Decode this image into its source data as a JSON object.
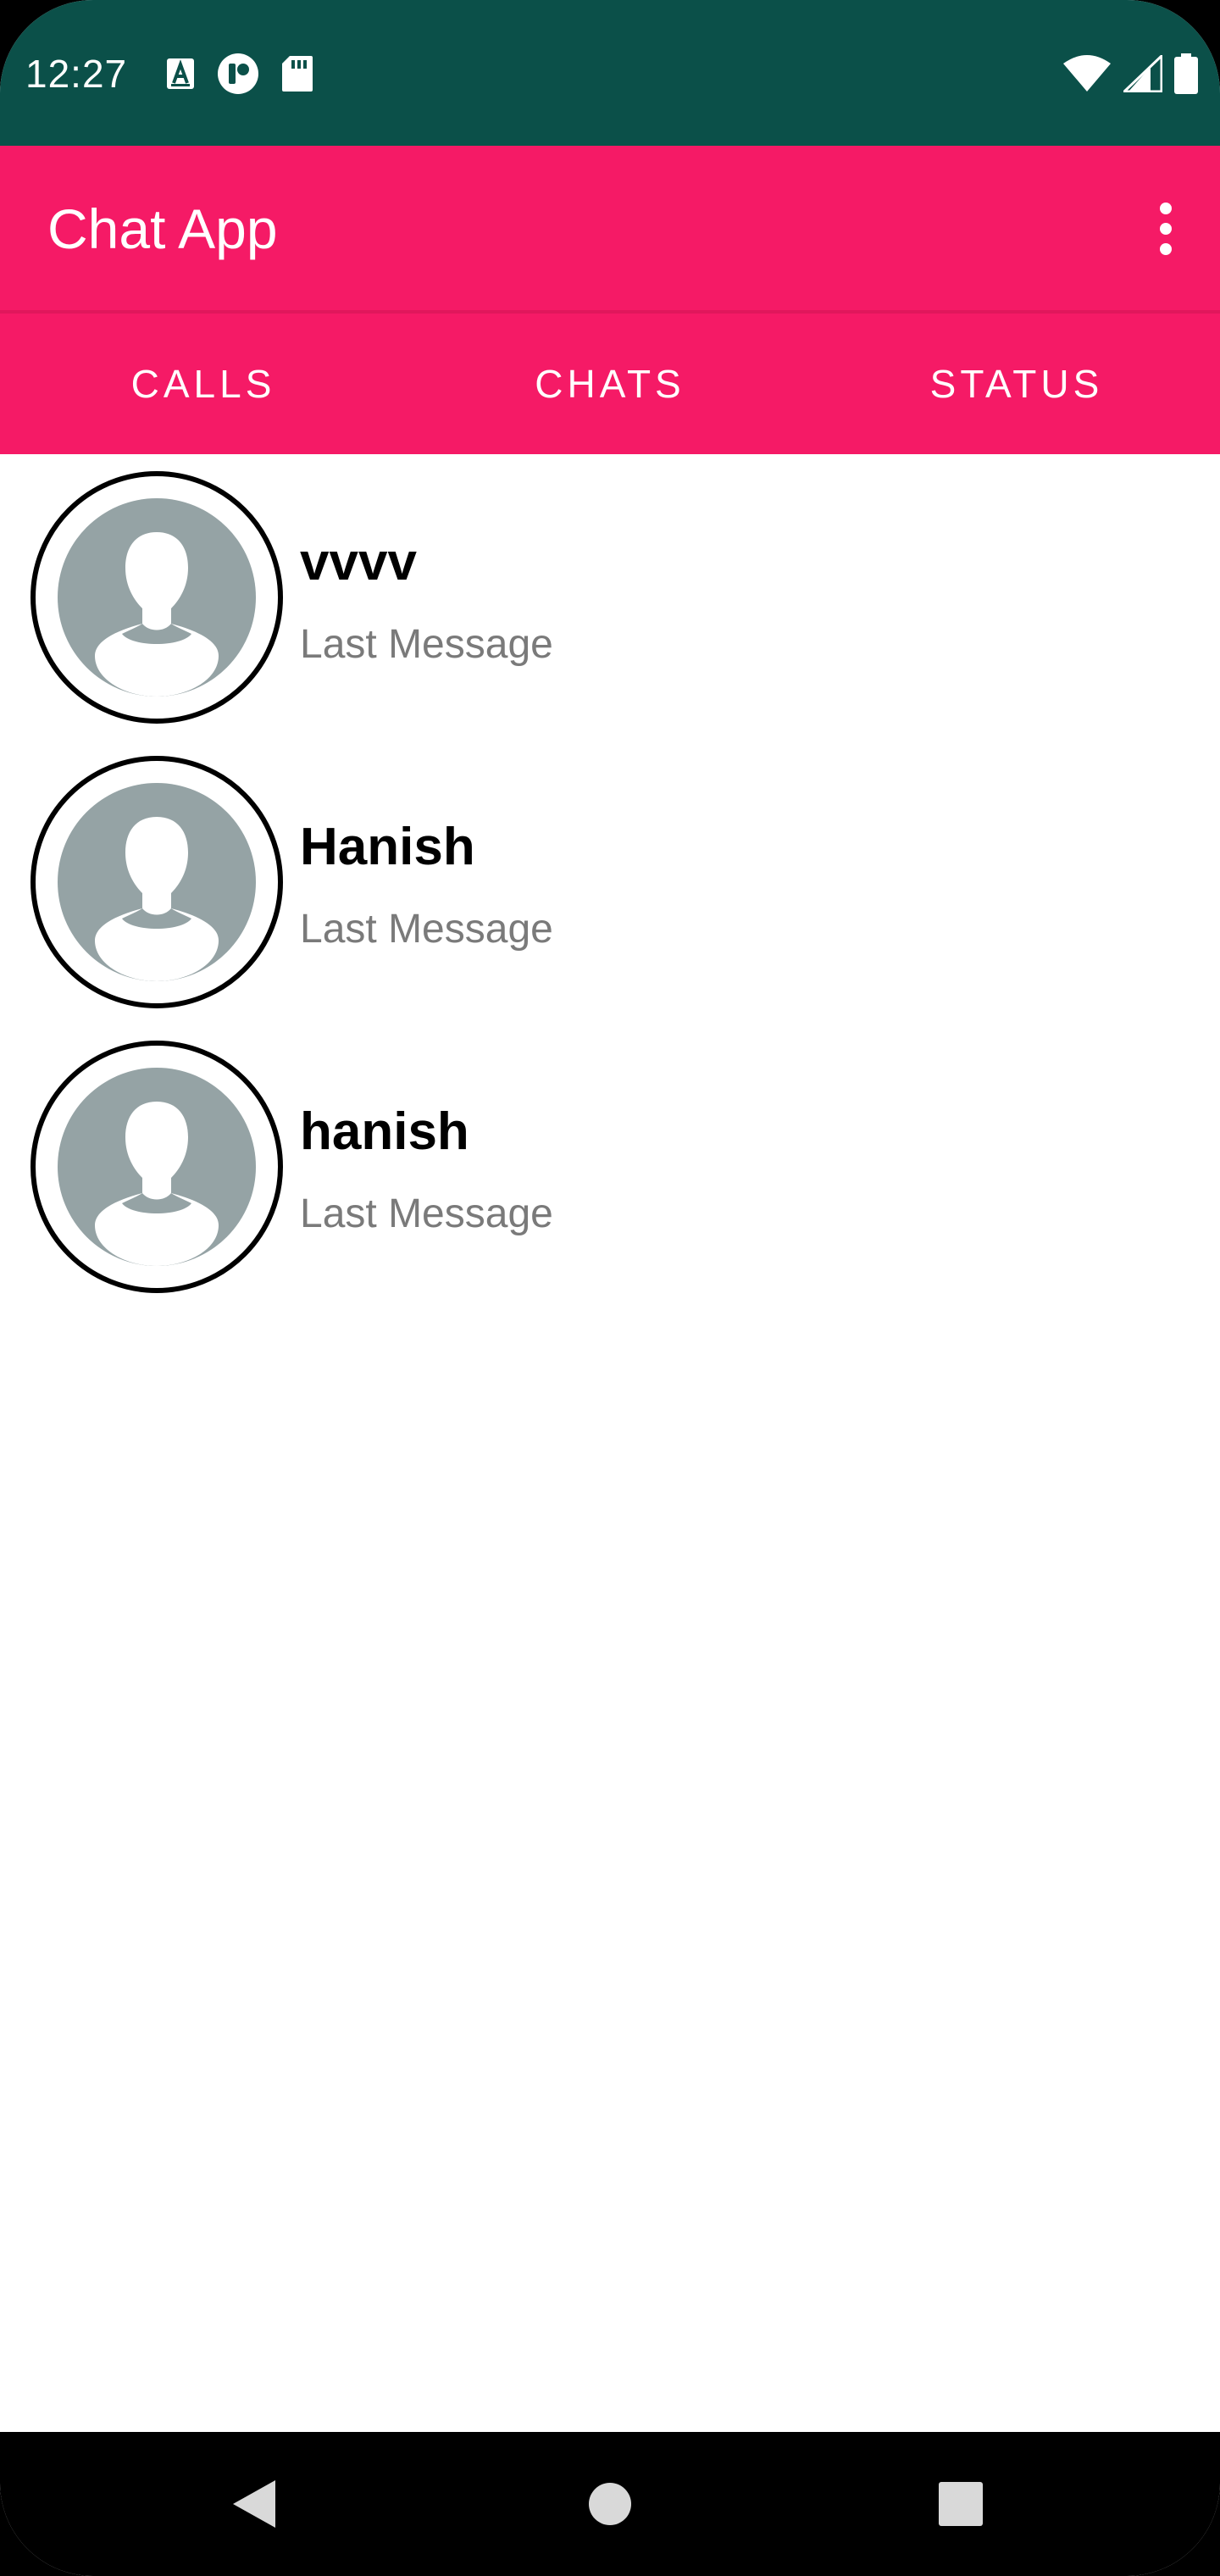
{
  "status_bar": {
    "time": "12:27",
    "left_icons": [
      "font-a-icon",
      "media-app-icon",
      "sd-card-icon"
    ],
    "right_icons": [
      "wifi-icon",
      "cell-signal-icon",
      "battery-icon"
    ],
    "background_color": "#0b5049"
  },
  "app_bar": {
    "title": "Chat App",
    "menu_icon": "more-vert-icon",
    "background_color": "#f51a66"
  },
  "tabs": [
    {
      "label": "CALLS"
    },
    {
      "label": "CHATS"
    },
    {
      "label": "STATUS"
    }
  ],
  "chats": [
    {
      "name": "vvvv",
      "last_message": "Last Message",
      "avatar": "default-avatar-icon"
    },
    {
      "name": "Hanish",
      "last_message": "Last Message",
      "avatar": "default-avatar-icon"
    },
    {
      "name": "hanish",
      "last_message": "Last Message",
      "avatar": "default-avatar-icon"
    }
  ],
  "nav_bar": {
    "buttons": [
      "back-icon",
      "home-icon",
      "recents-icon"
    ]
  }
}
